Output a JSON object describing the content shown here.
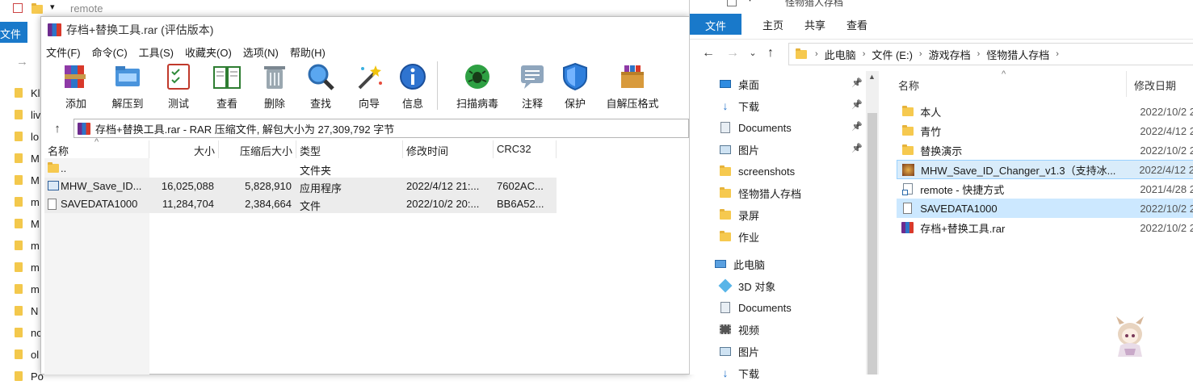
{
  "background_window": {
    "title": "remote",
    "ribbon_file_tab": "文件",
    "items": [
      "Kl",
      "liv",
      "lo",
      "M",
      "M",
      "m",
      "M",
      "m",
      "m",
      "m",
      "N",
      "nc",
      "ol",
      "Po"
    ]
  },
  "winrar": {
    "title": "存档+替换工具.rar (评估版本)",
    "menu": [
      "文件(F)",
      "命令(C)",
      "工具(S)",
      "收藏夹(O)",
      "选项(N)",
      "帮助(H)"
    ],
    "toolbar": [
      {
        "label": "添加",
        "icon": "add-icon"
      },
      {
        "label": "解压到",
        "icon": "extract-to-icon"
      },
      {
        "label": "测试",
        "icon": "test-icon"
      },
      {
        "label": "查看",
        "icon": "view-icon"
      },
      {
        "label": "删除",
        "icon": "delete-icon"
      },
      {
        "label": "查找",
        "icon": "find-icon"
      },
      {
        "label": "向导",
        "icon": "wizard-icon"
      },
      {
        "label": "信息",
        "icon": "info-icon"
      },
      {
        "label": "扫描病毒",
        "icon": "virus-scan-icon"
      },
      {
        "label": "注释",
        "icon": "comment-icon"
      },
      {
        "label": "保护",
        "icon": "protect-icon"
      },
      {
        "label": "自解压格式",
        "icon": "sfx-icon"
      }
    ],
    "path": "存档+替换工具.rar - RAR 压缩文件, 解包大小为 27,309,792 字节",
    "columns": [
      "名称",
      "大小",
      "压缩后大小",
      "类型",
      "修改时间",
      "CRC32"
    ],
    "rows": [
      {
        "name": "..",
        "size": "",
        "packed": "",
        "type": "文件夹",
        "modified": "",
        "crc": ""
      },
      {
        "name": "MHW_Save_ID...",
        "size": "16,025,088",
        "packed": "5,828,910",
        "type": "应用程序",
        "modified": "2022/4/12 21:...",
        "crc": "7602AC..."
      },
      {
        "name": "SAVEDATA1000",
        "size": "11,284,704",
        "packed": "2,384,664",
        "type": "文件",
        "modified": "2022/10/2 20:...",
        "crc": "BB6A52..."
      }
    ]
  },
  "explorer": {
    "title": "怪物猎人存档",
    "ribbon_tabs": [
      "文件",
      "主页",
      "共享",
      "查看"
    ],
    "breadcrumb": [
      "此电脑",
      "文件 (E:)",
      "游戏存档",
      "怪物猎人存档"
    ],
    "nav_items": [
      {
        "label": "桌面",
        "icon": "desktop-icon",
        "pinned": true
      },
      {
        "label": "下载",
        "icon": "downloads-icon",
        "pinned": true
      },
      {
        "label": "Documents",
        "icon": "documents-icon",
        "pinned": true
      },
      {
        "label": "图片",
        "icon": "pictures-icon",
        "pinned": true
      },
      {
        "label": "screenshots",
        "icon": "folder-icon",
        "pinned": false
      },
      {
        "label": "怪物猎人存档",
        "icon": "folder-icon",
        "pinned": false
      },
      {
        "label": "录屏",
        "icon": "folder-icon",
        "pinned": false
      },
      {
        "label": "作业",
        "icon": "folder-icon",
        "pinned": false
      },
      {
        "label": "此电脑",
        "icon": "this-pc-icon",
        "pinned": false
      },
      {
        "label": "3D 对象",
        "icon": "3d-objects-icon",
        "pinned": false
      },
      {
        "label": "Documents",
        "icon": "documents-icon",
        "pinned": false
      },
      {
        "label": "视频",
        "icon": "videos-icon",
        "pinned": false
      },
      {
        "label": "图片",
        "icon": "pictures-icon",
        "pinned": false
      },
      {
        "label": "下载",
        "icon": "downloads-icon",
        "pinned": false
      }
    ],
    "columns": {
      "name": "名称",
      "date": "修改日期"
    },
    "files": [
      {
        "name": "本人",
        "date": "2022/10/2 2",
        "icon": "folder-icon"
      },
      {
        "name": "青竹",
        "date": "2022/4/12 2",
        "icon": "folder-icon"
      },
      {
        "name": "替换演示",
        "date": "2022/10/2 2",
        "icon": "folder-icon"
      },
      {
        "name": "MHW_Save_ID_Changer_v1.3（支持冰...",
        "date": "2022/4/12 2",
        "icon": "app-icon"
      },
      {
        "name": "remote - 快捷方式",
        "date": "2021/4/28 2",
        "icon": "shortcut-icon"
      },
      {
        "name": "SAVEDATA1000",
        "date": "2022/10/2 2",
        "icon": "document-icon"
      },
      {
        "name": "存档+替换工具.rar",
        "date": "2022/10/2 2",
        "icon": "rar-icon"
      }
    ]
  },
  "colors": {
    "accent": "#1979ca",
    "selection": "#cce8ff",
    "folder": "#f6c94f"
  }
}
